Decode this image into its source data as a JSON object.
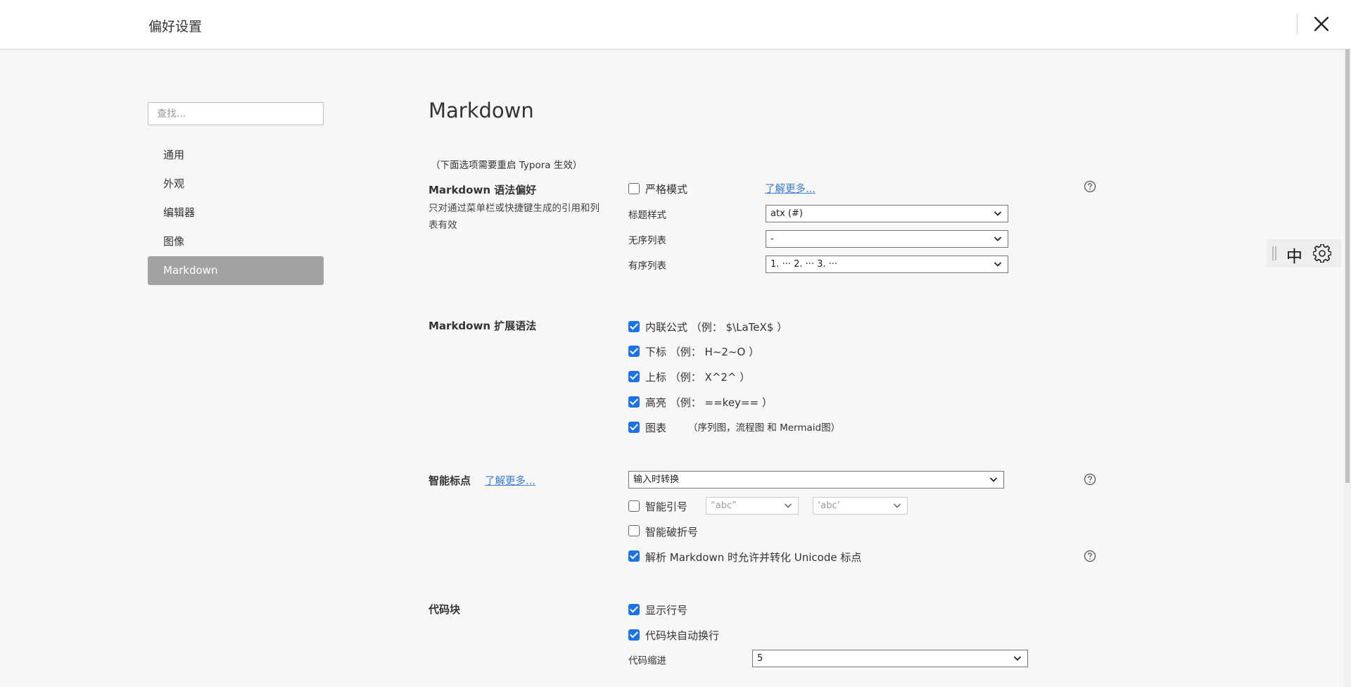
{
  "window": {
    "title": "偏好设置"
  },
  "sidebar": {
    "search_placeholder": "查找...",
    "items": [
      {
        "label": "通用"
      },
      {
        "label": "外观"
      },
      {
        "label": "编辑器"
      },
      {
        "label": "图像"
      },
      {
        "label": "Markdown"
      }
    ]
  },
  "main": {
    "title": "Markdown",
    "restart_note": "（下面选项需要重启 Typora 生效）",
    "syntax_pref": {
      "heading": "Markdown 语法偏好",
      "description": "只对通过菜单栏或快捷键生成的引用和列表有效",
      "strict_mode_label": "严格模式",
      "strict_mode_checked": false,
      "learn_more": "了解更多...",
      "heading_style_label": "标题样式",
      "heading_style_value": "atx (#)",
      "unordered_list_label": "无序列表",
      "unordered_list_value": "-",
      "ordered_list_label": "有序列表",
      "ordered_list_value": "1. ··· 2. ··· 3. ···"
    },
    "extended_syntax": {
      "heading": "Markdown 扩展语法",
      "options": [
        {
          "label": "内联公式 （例： $\\LaTeX$ ）",
          "checked": true
        },
        {
          "label": "下标 （例： H~2~O ）",
          "checked": true
        },
        {
          "label": "上标 （例： X^2^ ）",
          "checked": true
        },
        {
          "label": "高亮 （例： ==key== ）",
          "checked": true
        },
        {
          "label": "图表",
          "checked": true
        }
      ],
      "diagram_note": "（序列图，流程图 和 Mermaid图）"
    },
    "smart_punct": {
      "heading": "智能标点",
      "learn_more": "了解更多...",
      "mode_value": "输入时转换",
      "smart_quotes_label": "智能引号",
      "smart_quotes_checked": false,
      "double_quote_value": "“abc”",
      "single_quote_value": "‘abc’",
      "smart_dash_label": "智能破折号",
      "smart_dash_checked": false,
      "unicode_label": "解析 Markdown 时允许并转化 Unicode 标点",
      "unicode_checked": true
    },
    "code_block": {
      "heading": "代码块",
      "line_numbers_label": "显示行号",
      "line_numbers_checked": true,
      "auto_wrap_label": "代码块自动换行",
      "auto_wrap_checked": true,
      "indent_label": "代码缩进",
      "indent_value": "5"
    }
  },
  "ime": {
    "mode": "中"
  },
  "colors": {
    "checkbox": "#1a73e8",
    "link": "#3b7bd0",
    "nav_active": "#a2a2a2"
  }
}
